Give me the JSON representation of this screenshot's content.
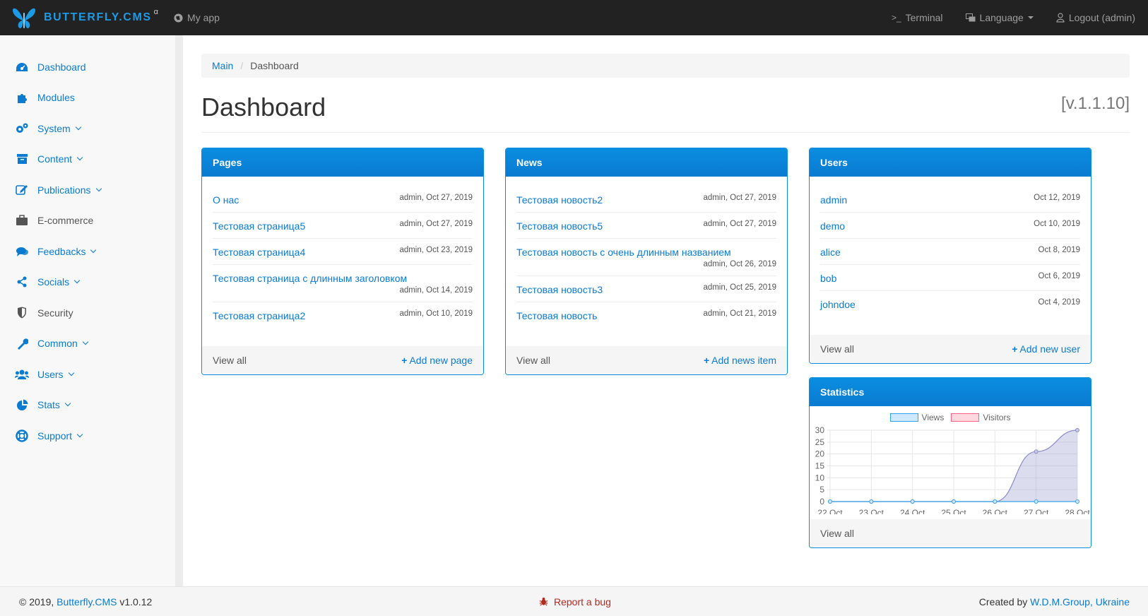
{
  "topbar": {
    "brand": "BUTTERFLY.CMS",
    "brand_sup": "α",
    "app": "My app",
    "terminal": "Terminal",
    "terminal_icon": ">_",
    "language": "Language",
    "logout": "Logout (admin)"
  },
  "sidebar": {
    "items": [
      {
        "label": "Dashboard",
        "icon": "dashboard-icon",
        "chevron": false
      },
      {
        "label": "Modules",
        "icon": "puzzle-icon",
        "chevron": false
      },
      {
        "label": "System",
        "icon": "gears-icon",
        "chevron": true
      },
      {
        "label": "Content",
        "icon": "archive-icon",
        "chevron": true
      },
      {
        "label": "Publications",
        "icon": "edit-icon",
        "chevron": true
      },
      {
        "label": "E-commerce",
        "icon": "briefcase-icon",
        "chevron": false
      },
      {
        "label": "Feedbacks",
        "icon": "comments-icon",
        "chevron": true
      },
      {
        "label": "Socials",
        "icon": "share-icon",
        "chevron": true
      },
      {
        "label": "Security",
        "icon": "shield-icon",
        "chevron": false
      },
      {
        "label": "Common",
        "icon": "wrench-icon",
        "chevron": true
      },
      {
        "label": "Users",
        "icon": "users-icon",
        "chevron": true
      },
      {
        "label": "Stats",
        "icon": "pie-chart-icon",
        "chevron": true
      },
      {
        "label": "Support",
        "icon": "lifebuoy-icon",
        "chevron": true
      }
    ]
  },
  "breadcrumb": {
    "main": "Main",
    "sep": "/",
    "current": "Dashboard"
  },
  "page": {
    "title": "Dashboard",
    "version": "[v.1.1.10]"
  },
  "pages_panel": {
    "title": "Pages",
    "items": [
      {
        "title": "О нас",
        "meta": "admin, Oct 27, 2019"
      },
      {
        "title": "Тестовая страница5",
        "meta": "admin, Oct 27, 2019"
      },
      {
        "title": "Тестовая страница4",
        "meta": "admin, Oct 23, 2019"
      },
      {
        "title": "Тестовая страница с длинным заголовком",
        "meta": "admin, Oct 14, 2019"
      },
      {
        "title": "Тестовая страница2",
        "meta": "admin, Oct 10, 2019"
      }
    ],
    "view_all": "View all",
    "add": "Add new page"
  },
  "news_panel": {
    "title": "News",
    "items": [
      {
        "title": "Тестовая новость2",
        "meta": "admin, Oct 27, 2019"
      },
      {
        "title": "Тестовая новость5",
        "meta": "admin, Oct 27, 2019"
      },
      {
        "title": "Тестовая новость с очень длинным названием",
        "meta": "admin, Oct 26, 2019"
      },
      {
        "title": "Тестовая новость3",
        "meta": "admin, Oct 25, 2019"
      },
      {
        "title": "Тестовая новость",
        "meta": "admin, Oct 21, 2019"
      }
    ],
    "view_all": "View all",
    "add": "Add news item"
  },
  "users_panel": {
    "title": "Users",
    "items": [
      {
        "title": "admin",
        "meta": "Oct 12, 2019"
      },
      {
        "title": "demo",
        "meta": "Oct 10, 2019"
      },
      {
        "title": "alice",
        "meta": "Oct 8, 2019"
      },
      {
        "title": "bob",
        "meta": "Oct 6, 2019"
      },
      {
        "title": "johndoe",
        "meta": "Oct 4, 2019"
      }
    ],
    "view_all": "View all",
    "add": "Add new user"
  },
  "stats_panel": {
    "title": "Statistics",
    "view_all": "View all"
  },
  "chart_data": {
    "type": "area",
    "categories": [
      "22 Oct",
      "23 Oct",
      "24 Oct",
      "25 Oct",
      "26 Oct",
      "27 Oct",
      "28 Oct"
    ],
    "series": [
      {
        "name": "Views",
        "values": [
          0,
          0,
          0,
          0,
          0,
          0,
          0
        ],
        "color": "#36a2eb"
      },
      {
        "name": "Visitors",
        "values": [
          0,
          0,
          0,
          0,
          0,
          21,
          30
        ],
        "color": "#9b9bd0"
      }
    ],
    "yticks": [
      "30",
      "25",
      "20",
      "15",
      "10",
      "5",
      "0"
    ],
    "ylim": [
      0,
      30
    ],
    "legend": "top",
    "grid": true
  },
  "footer": {
    "copyright": "© 2019, ",
    "cms_link": "Butterfly.CMS",
    "version": " v1.0.12",
    "report": "Report a bug",
    "created_by": "Created by ",
    "company": "W.D.M.Group, Ukraine"
  },
  "colors": {
    "accent": "#0a7bd1",
    "topbar": "#222222",
    "bug": "#b52a1f"
  }
}
